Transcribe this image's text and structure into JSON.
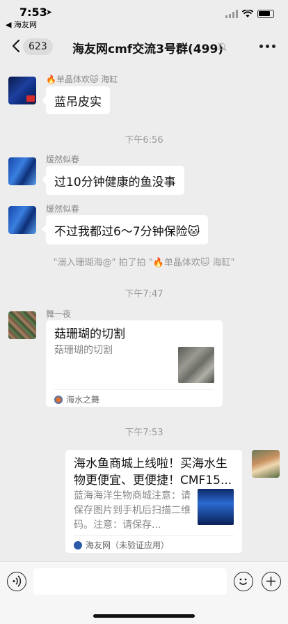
{
  "status_bar": {
    "time": "7:53",
    "back_app": "◀ 海友网"
  },
  "header": {
    "back_count": "623",
    "title": "海友网cmf交流3号群(499)"
  },
  "messages": [
    {
      "sender": "🔥单晶体欢🐱 海缸",
      "text": "蓝吊皮实"
    },
    {
      "timestamp": "下午6:56"
    },
    {
      "sender": "煖然似春",
      "text": "过10分钟健康的鱼没事"
    },
    {
      "sender": "煖然似春",
      "text": "不过我都过6～7分钟保险🐱"
    },
    {
      "system": "\"溺入珊瑚海@\" 拍了拍 \"🔥单晶体欢🐱 海缸\""
    },
    {
      "timestamp": "下午7:47"
    },
    {
      "sender": "舞一夜",
      "card": {
        "title": "菇珊瑚的切割",
        "desc": "菇珊瑚的切割",
        "source": "海水之舞"
      }
    },
    {
      "timestamp": "下午7:53"
    },
    {
      "card": {
        "title": "海水鱼商城上线啦！买海水生物更便宜、更便捷！CMF15...",
        "desc": "蓝海海洋生物商城注意：请保存图片到手机后扫描二维码。注意：请保存...",
        "source": "海友网（未验证应用）"
      }
    }
  ]
}
